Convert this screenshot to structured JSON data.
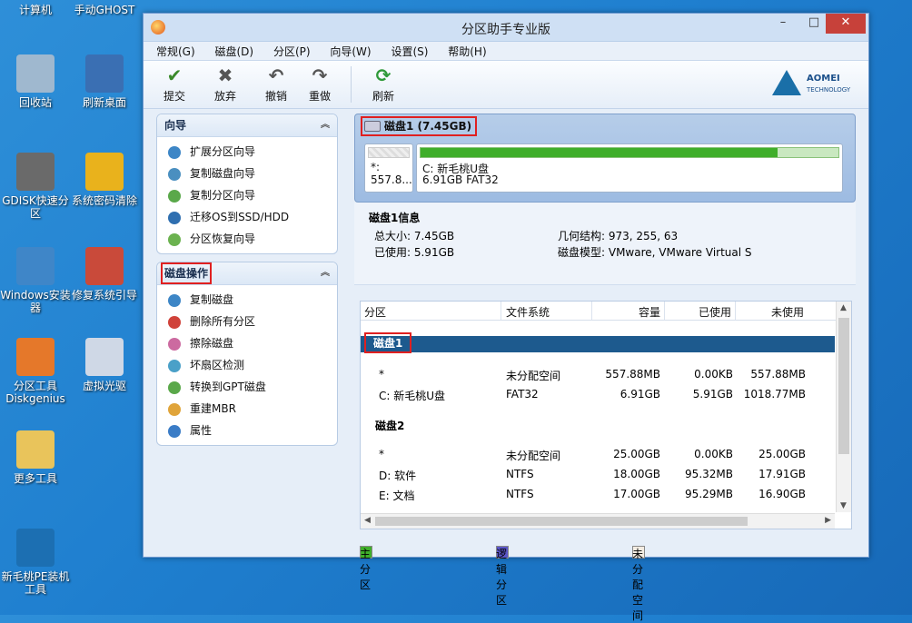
{
  "desktop": {
    "icons": [
      {
        "label": "计算机",
        "icon": "computer-icon"
      },
      {
        "label": "手动GHOST",
        "icon": "ghost-icon"
      },
      {
        "label": "回收站",
        "icon": "recycle-bin-icon"
      },
      {
        "label": "刷新桌面",
        "icon": "refresh-desktop-icon"
      },
      {
        "label": "GDISK快速分区",
        "icon": "gdisk-icon"
      },
      {
        "label": "系统密码清除",
        "icon": "key-icon"
      },
      {
        "label": "Windows安装器",
        "icon": "windows-installer-icon"
      },
      {
        "label": "修复系统引导",
        "icon": "first-aid-icon"
      },
      {
        "label": "分区工具Diskgenius",
        "icon": "diskgenius-icon"
      },
      {
        "label": "虚拟光驱",
        "icon": "virtual-drive-icon"
      },
      {
        "label": "更多工具",
        "icon": "folder-icon"
      },
      {
        "label": "新毛桃PE装机工具",
        "icon": "pe-installer-icon"
      }
    ]
  },
  "window": {
    "title": "分区助手专业版",
    "close_label": "✕",
    "min_label": "–",
    "max_label": "□"
  },
  "menu": [
    "常规(G)",
    "磁盘(D)",
    "分区(P)",
    "向导(W)",
    "设置(S)",
    "帮助(H)"
  ],
  "toolbar": {
    "submit": "提交",
    "discard": "放弃",
    "undo": "撤销",
    "redo": "重做",
    "refresh": "刷新",
    "logo_top": "AOMEI",
    "logo_bottom": "TECHNOLOGY"
  },
  "wizard": {
    "title": "向导",
    "items": [
      "扩展分区向导",
      "复制磁盘向导",
      "复制分区向导",
      "迁移OS到SSD/HDD",
      "分区恢复向导"
    ]
  },
  "disk_ops": {
    "title": "磁盘操作",
    "items": [
      "复制磁盘",
      "删除所有分区",
      "擦除磁盘",
      "坏扇区检测",
      "转换到GPT磁盘",
      "重建MBR",
      "属性"
    ]
  },
  "disk_card": {
    "name": "磁盘1 (7.45GB)",
    "part1_line1": "*:",
    "part1_line2": "557.8...",
    "part2_line1": "C:  新毛桃U盘",
    "part2_line2": "6.91GB FAT32",
    "part2_used_fraction": 0.855
  },
  "disk_info": {
    "title": "磁盘1信息",
    "total": "总大小: 7.45GB",
    "used": "已使用: 5.91GB",
    "geometry": "几何结构: 973, 255, 63",
    "model": "磁盘模型: VMware, VMware Virtual S"
  },
  "table": {
    "headers": [
      "分区",
      "文件系统",
      "容量",
      "已使用",
      "未使用"
    ],
    "disk1": "磁盘1",
    "disk2": "磁盘2",
    "rows_disk1": [
      [
        "*",
        "未分配空间",
        "557.88MB",
        "0.00KB",
        "557.88MB"
      ],
      [
        "C: 新毛桃U盘",
        "FAT32",
        "6.91GB",
        "5.91GB",
        "1018.77MB"
      ]
    ],
    "rows_disk2": [
      [
        "*",
        "未分配空间",
        "25.00GB",
        "0.00KB",
        "25.00GB"
      ],
      [
        "D: 软件",
        "NTFS",
        "18.00GB",
        "95.32MB",
        "17.91GB"
      ],
      [
        "E: 文档",
        "NTFS",
        "17.00GB",
        "95.29MB",
        "16.90GB"
      ]
    ]
  },
  "legend": {
    "primary": "主分区",
    "logical": "逻辑分区",
    "unallocated": "未分配空间",
    "primary_color": "#3fae2a",
    "logical_color": "#5a55c8",
    "unallocated_color": "#f3ece2"
  }
}
